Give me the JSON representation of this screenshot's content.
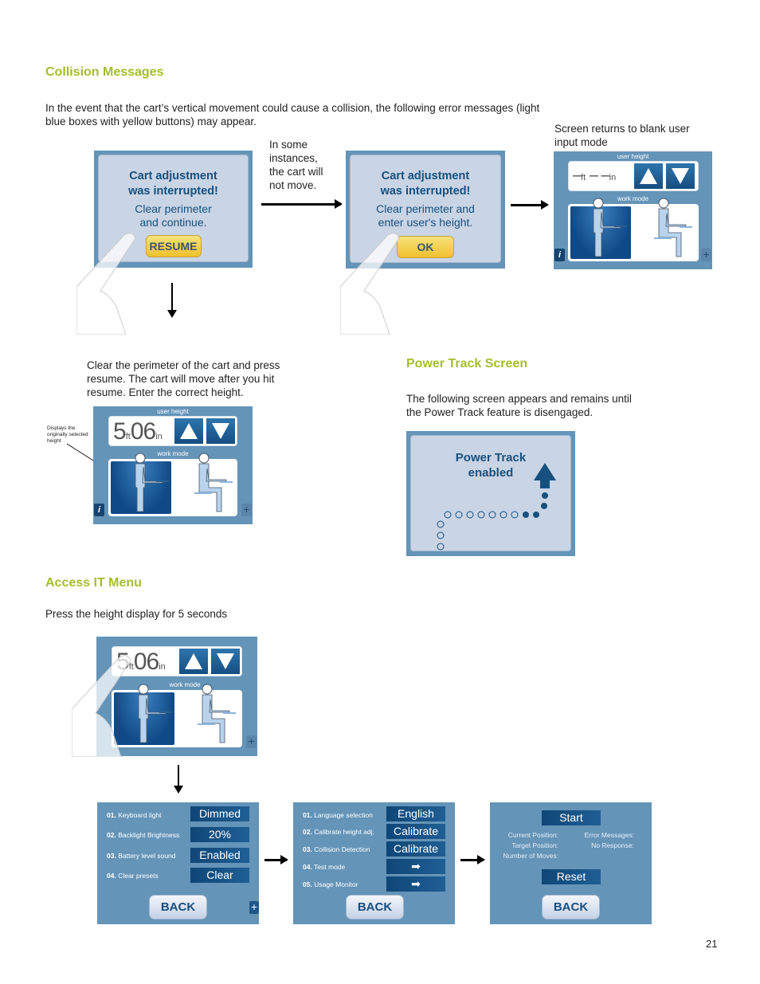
{
  "collision": {
    "heading": "Collision Messages",
    "intro": "In the event that the cart’s vertical movement could cause a collision, the following error messages (light blue boxes with yellow buttons) may appear.",
    "note_no_move": "In some instances, the cart will not move.",
    "note_returns": "Screen returns to blank user input mode",
    "dialog1": {
      "title": "Cart adjustment was interrupted!",
      "message": "Clear perimeter and continue.",
      "button": "RESUME"
    },
    "dialog2": {
      "title": "Cart adjustment was interrupted!",
      "message": "Clear perimeter and enter user's height.",
      "button": "OK"
    },
    "after_text": "Clear the perimeter of the cart and press resume. The cart will move after you hit resume. Enter the correct height.",
    "annotation": "Displays the originally selected height"
  },
  "height_panel": {
    "user_height_label": "user height",
    "work_mode_label": "work mode",
    "ft_unit": "ft",
    "in_unit": "in",
    "feet": "5",
    "inches": "06",
    "blank_feet": "–",
    "blank_inches": "– –",
    "info": "i",
    "plus": "+"
  },
  "power_track": {
    "heading": "Power Track Screen",
    "text": "The following screen appears and remains until the Power Track feature is disengaged.",
    "line1": "Power Track",
    "line2": "enabled"
  },
  "access": {
    "heading": "Access IT Menu",
    "text": "Press the height display for 5 seconds",
    "menu1": [
      {
        "num": "01.",
        "label": "Keyboard light",
        "value": "Dimmed"
      },
      {
        "num": "02.",
        "label": "Backlight Brightness",
        "value": "20%"
      },
      {
        "num": "03.",
        "label": "Battery level sound",
        "value": "Enabled"
      },
      {
        "num": "04.",
        "label": "Clear presets",
        "value": "Clear"
      }
    ],
    "menu2": [
      {
        "num": "01.",
        "label": "Language selection",
        "value": "English"
      },
      {
        "num": "02.",
        "label": "Calibrate height adj.",
        "value": "Calibrate"
      },
      {
        "num": "03.",
        "label": "Collision Detection",
        "value": "Calibrate"
      },
      {
        "num": "04.",
        "label": "Test mode",
        "value": "➡"
      },
      {
        "num": "05.",
        "label": "Usage Monitor",
        "value": "➡"
      }
    ],
    "menu3": {
      "start": "Start",
      "current": "Current Position:",
      "target": "Target Position:",
      "moves": "Number of Moves:",
      "errors": "Error Messages:",
      "noresp": "No Response:",
      "reset": "Reset"
    },
    "back": "BACK"
  },
  "page_number": "21",
  "colors": {
    "heading": "#a3bf2b",
    "panel": "#6494b8",
    "button": "#154e82",
    "dialog": "#c9d4e5",
    "yellow": "#f0c12c"
  }
}
